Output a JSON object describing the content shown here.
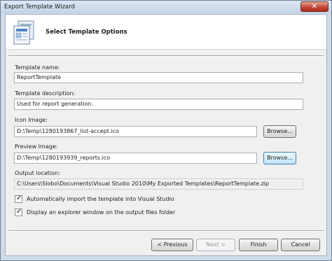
{
  "window": {
    "title": "Export Template Wizard",
    "close_symbol": "✕"
  },
  "header": {
    "title": "Select Template Options",
    "icon": "template-wizard-icon"
  },
  "form": {
    "template_name": {
      "label": "Template name:",
      "value": "ReportTemplate"
    },
    "template_description": {
      "label": "Template description:",
      "value": "Used for report generation."
    },
    "icon_image": {
      "label": "Icon Image:",
      "value": "D:\\Temp\\1280193867_list-accept.ico",
      "browse_label": "Browse..."
    },
    "preview_image": {
      "label": "Preview Image:",
      "value": "D:\\Temp\\1280193939_reports.ico",
      "browse_label": "Browse..."
    },
    "output_location": {
      "label": "Output location:",
      "value": "C:\\Users\\Slobo\\Documents\\Visual Studio 2010\\My Exported Templates\\ReportTemplate.zip"
    },
    "auto_import": {
      "label": "Automatically import the template into Visual Studio",
      "checked": true
    },
    "display_explorer": {
      "label": "Display an explorer window on the output files folder",
      "checked": true
    }
  },
  "checkmark": "✓",
  "buttons": {
    "previous": "< Previous",
    "next": "Next >",
    "finish": "Finish",
    "cancel": "Cancel"
  }
}
